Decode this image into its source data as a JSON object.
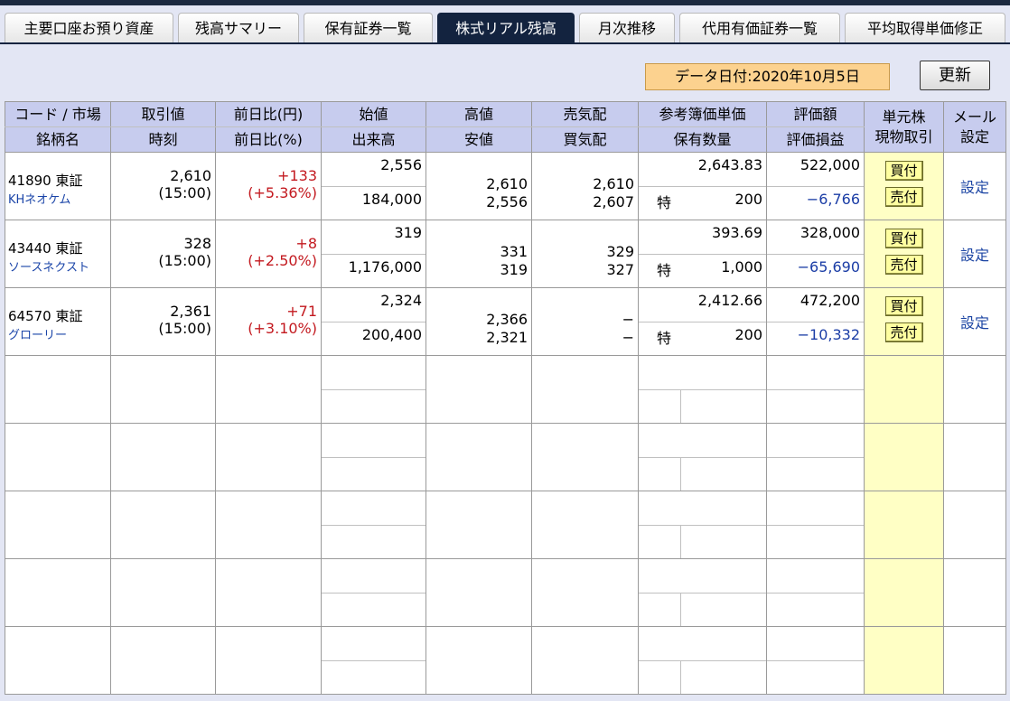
{
  "tabs": [
    {
      "label": "主要口座お預り資産"
    },
    {
      "label": "残高サマリー"
    },
    {
      "label": "保有証券一覧"
    },
    {
      "label": "株式リアル残高"
    },
    {
      "label": "月次推移"
    },
    {
      "label": "代用有価証券一覧"
    },
    {
      "label": "平均取得単価修正"
    }
  ],
  "active_tab": "株式リアル残高",
  "data_date": "データ日付:2020年10月5日",
  "refresh_label": "更新",
  "headers": {
    "code_market": "コード / 市場",
    "name": "銘柄名",
    "price": "取引値",
    "time": "時刻",
    "change_yen": "前日比(円)",
    "change_pct": "前日比(%)",
    "open": "始値",
    "volume": "出来高",
    "high": "高値",
    "low": "安値",
    "ask": "売気配",
    "bid": "買気配",
    "book_price": "参考簿価単価",
    "quantity": "保有数量",
    "value": "評価額",
    "pnl": "評価損益",
    "trade": "単元株\n現物取引",
    "mail": "メール\n設定"
  },
  "rows": [
    {
      "code_market": "41890  東証",
      "name": "KHネオケム",
      "price": "2,610",
      "time": "(15:00)",
      "change": "+133",
      "change_pct": "(+5.36%)",
      "open": "2,556",
      "volume": "184,000",
      "high": "2,610",
      "low": "2,556",
      "ask": "2,610",
      "bid": "2,607",
      "book_price": "2,643.83",
      "account_type": "特",
      "quantity": "200",
      "value": "522,000",
      "pnl": "−6,766",
      "buy": "買付",
      "sell": "売付",
      "mail": "設定"
    },
    {
      "code_market": "43440  東証",
      "name": "ソースネクスト",
      "price": "328",
      "time": "(15:00)",
      "change": "+8",
      "change_pct": "(+2.50%)",
      "open": "319",
      "volume": "1,176,000",
      "high": "331",
      "low": "319",
      "ask": "329",
      "bid": "327",
      "book_price": "393.69",
      "account_type": "特",
      "quantity": "1,000",
      "value": "328,000",
      "pnl": "−65,690",
      "buy": "買付",
      "sell": "売付",
      "mail": "設定"
    },
    {
      "code_market": "64570  東証",
      "name": "グローリー",
      "price": "2,361",
      "time": "(15:00)",
      "change": "+71",
      "change_pct": "(+3.10%)",
      "open": "2,324",
      "volume": "200,400",
      "high": "2,366",
      "low": "2,321",
      "ask": "−",
      "bid": "−",
      "book_price": "2,412.66",
      "account_type": "特",
      "quantity": "200",
      "value": "472,200",
      "pnl": "−10,332",
      "buy": "買付",
      "sell": "売付",
      "mail": "設定"
    }
  ],
  "colors": {
    "header_bg": "#c7ccee",
    "page_bg": "#e3e6f4",
    "positive": "#c3191f",
    "negative": "#1c3ea6",
    "trade_col": "#ffffc5",
    "active_tab": "#13233f"
  }
}
